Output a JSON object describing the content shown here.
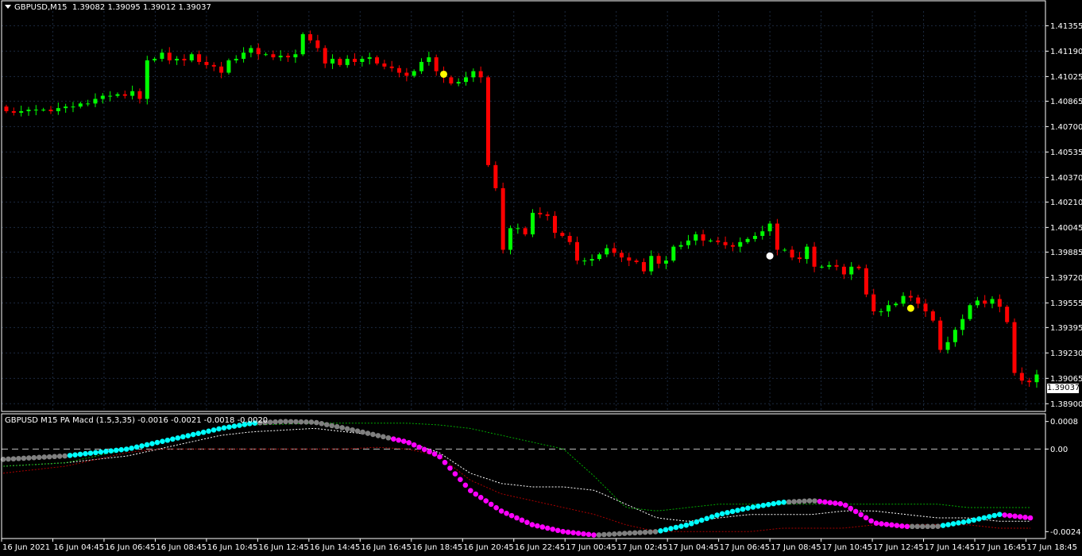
{
  "main_title": {
    "symbol_tf": "GBPUSD,M15",
    "ohlc": "1.39082 1.39095 1.39012 1.39037"
  },
  "sub_title": "GBPUSD M15 PA Macd (1.5,3,35) -0.0016 -0.0021 -0.0018 -0.0020",
  "last_price_tag": "1.39037",
  "colors": {
    "background": "#000000",
    "bull": "#00ff00",
    "bear": "#ff0000",
    "grid": "#1c2a40",
    "axis": "#ffffff",
    "macd_up": "#00ffff",
    "macd_down": "#ff00ff",
    "macd_neutral": "#808080",
    "signal_line": "#ffffff",
    "upper_band": "#00aa00",
    "lower_band": "#aa0000",
    "marker_yellow": "#ffff00",
    "marker_white": "#ffffff"
  },
  "chart_data": [
    {
      "type": "candlestick",
      "symbol": "GBPUSD",
      "timeframe": "M15",
      "ylim": [
        1.3885,
        1.4145
      ],
      "y_ticks": [
        "1.41355",
        "1.41190",
        "1.41025",
        "1.40865",
        "1.40700",
        "1.40535",
        "1.40370",
        "1.40210",
        "1.40045",
        "1.39885",
        "1.39720",
        "1.39555",
        "1.39395",
        "1.39230",
        "1.39065",
        "1.38900"
      ],
      "x_ticks": [
        "16 Jun 2021",
        "16 Jun 04:45",
        "16 Jun 06:45",
        "16 Jun 08:45",
        "16 Jun 10:45",
        "16 Jun 12:45",
        "16 Jun 14:45",
        "16 Jun 16:45",
        "16 Jun 18:45",
        "16 Jun 20:45",
        "16 Jun 22:45",
        "17 Jun 00:45",
        "17 Jun 02:45",
        "17 Jun 04:45",
        "17 Jun 06:45",
        "17 Jun 08:45",
        "17 Jun 10:45",
        "17 Jun 12:45",
        "17 Jun 14:45",
        "17 Jun 16:45",
        "17 Jun 18:45"
      ],
      "close_path": [
        1.408,
        1.4079,
        1.408,
        1.4081,
        1.4081,
        1.4081,
        1.408,
        1.4082,
        1.4083,
        1.4083,
        1.4085,
        1.4085,
        1.4088,
        1.409,
        1.409,
        1.4091,
        1.409,
        1.4093,
        1.4088,
        1.4113,
        1.4114,
        1.4118,
        1.4113,
        1.4114,
        1.4113,
        1.4117,
        1.4112,
        1.411,
        1.4109,
        1.4105,
        1.4113,
        1.4114,
        1.4118,
        1.4121,
        1.4117,
        1.4117,
        1.4115,
        1.4116,
        1.4115,
        1.4117,
        1.413,
        1.4126,
        1.4121,
        1.4111,
        1.4114,
        1.411,
        1.4114,
        1.4112,
        1.4114,
        1.4115,
        1.4111,
        1.4109,
        1.4108,
        1.4105,
        1.4103,
        1.4106,
        1.4112,
        1.4115,
        1.4106,
        1.4102,
        1.4098,
        1.4099,
        1.4102,
        1.4106,
        1.4102,
        1.4045,
        1.403,
        1.399,
        1.4004,
        1.4004,
        1.4,
        1.4014,
        1.4013,
        1.4012,
        1.4001,
        1.3999,
        1.3995,
        1.3983,
        1.3983,
        1.3984,
        1.3987,
        1.3991,
        1.3988,
        1.3985,
        1.3983,
        1.3982,
        1.3976,
        1.3986,
        1.3981,
        1.3983,
        1.3992,
        1.3993,
        1.3996,
        1.4,
        1.3996,
        1.3996,
        1.3995,
        1.3993,
        1.3992,
        1.3995,
        1.3997,
        1.3999,
        1.4002,
        1.4007,
        1.399,
        1.399,
        1.3985,
        1.3984,
        1.3992,
        1.3979,
        1.3979,
        1.398,
        1.3979,
        1.3974,
        1.3979,
        1.3978,
        1.3961,
        1.395,
        1.395,
        1.3954,
        1.3955,
        1.396,
        1.3959,
        1.3955,
        1.395,
        1.3944,
        1.3925,
        1.393,
        1.3938,
        1.3945,
        1.3954,
        1.3957,
        1.3955,
        1.3958,
        1.3953,
        1.3943,
        1.391,
        1.3905,
        1.3904,
        1.3909
      ],
      "markers": [
        {
          "index": 59,
          "price": 1.4104,
          "color": "yellow"
        },
        {
          "index": 103,
          "price": 1.3986,
          "color": "white"
        },
        {
          "index": 122,
          "price": 1.3952,
          "color": "yellow"
        }
      ],
      "last_price": 1.39037
    },
    {
      "type": "line",
      "title": "GBPUSD M15 PA Macd (1.5,3,35)",
      "ylim": [
        -0.0026,
        0.001
      ],
      "y_ticks": [
        "0.0008",
        "0.00",
        "-0.0024"
      ],
      "values_shown": [
        -0.0016,
        -0.0021,
        -0.0018,
        -0.002
      ],
      "series": [
        {
          "name": "",
          "kind": "dots",
          "values": [
            -0.0003,
            -0.00025,
            -0.0002,
            -0.0001,
            0.0,
            0.0002,
            0.0004,
            0.0006,
            0.00075,
            0.0008,
            0.00078,
            0.0006,
            0.0004,
            0.0002,
            -0.0002,
            -0.0012,
            -0.0018,
            -0.0022,
            -0.0024,
            -0.0025,
            -0.00245,
            -0.0024,
            -0.0022,
            -0.0019,
            -0.0017,
            -0.00155,
            -0.0015,
            -0.0016,
            -0.00215,
            -0.00225,
            -0.00225,
            -0.0021,
            -0.0019,
            -0.002
          ]
        },
        {
          "name": "",
          "kind": "dashed-white",
          "values": [
            -0.0005,
            -0.00045,
            -0.0004,
            -0.0003,
            -0.0002,
            0.0,
            0.0002,
            0.0004,
            0.0005,
            0.00055,
            0.0006,
            0.0005,
            0.0004,
            0.0002,
            -0.0001,
            -0.0007,
            -0.001,
            -0.0011,
            -0.0011,
            -0.0012,
            -0.0016,
            -0.002,
            -0.0021,
            -0.002,
            -0.0019,
            -0.0019,
            -0.0019,
            -0.0018,
            -0.0018,
            -0.0019,
            -0.002,
            -0.002,
            -0.0021,
            -0.0021
          ]
        },
        {
          "name": "",
          "kind": "dashed-green",
          "values": [
            -0.0005,
            -0.00045,
            -0.0004,
            -0.0002,
            0.0,
            0.0002,
            0.0004,
            0.0006,
            0.0007,
            0.00072,
            0.00075,
            0.00075,
            0.00075,
            0.00075,
            0.0007,
            0.0006,
            0.0004,
            0.0002,
            0.0,
            -0.0008,
            -0.0017,
            -0.0018,
            -0.0017,
            -0.0016,
            -0.0016,
            -0.0016,
            -0.0016,
            -0.0016,
            -0.0016,
            -0.0016,
            -0.0016,
            -0.0017,
            -0.0017,
            -0.0017
          ]
        },
        {
          "name": "",
          "kind": "dashed-red",
          "values": [
            -0.0007,
            -0.0006,
            -0.0005,
            -0.0003,
            -0.0001,
            0.0,
            0.0,
            0.0,
            0.0,
            0.0,
            0.0,
            0.0,
            5e-05,
            0.0,
            -0.0002,
            -0.0009,
            -0.0013,
            -0.0015,
            -0.0017,
            -0.0019,
            -0.0022,
            -0.0024,
            -0.0024,
            -0.0024,
            -0.0024,
            -0.0023,
            -0.0023,
            -0.0023,
            -0.0022,
            -0.0022,
            -0.0022,
            -0.0022,
            -0.0023,
            -0.0023
          ]
        }
      ],
      "zero_line": 0
    }
  ]
}
